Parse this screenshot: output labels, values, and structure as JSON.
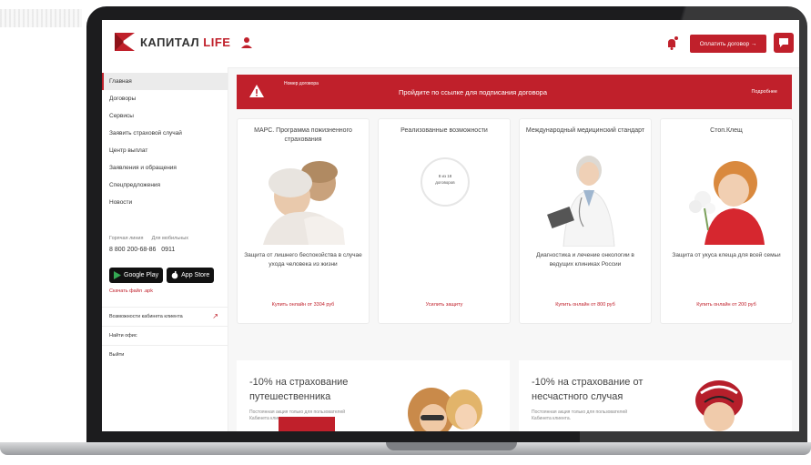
{
  "header": {
    "logo_text": "КАПИТАЛ",
    "logo_life": "LIFE",
    "pay_button": "Оплатить договор →"
  },
  "sidebar": {
    "items": [
      {
        "label": "Главная"
      },
      {
        "label": "Договоры"
      },
      {
        "label": "Сервисы"
      },
      {
        "label": "Заявить страховой случай"
      },
      {
        "label": "Центр выплат"
      },
      {
        "label": "Заявления и обращения"
      },
      {
        "label": "Спецпредложения"
      },
      {
        "label": "Новости"
      }
    ],
    "hotline_label": "Горячая линия",
    "mobile_label": "Для мобильных",
    "hotline_number": "8 800 200-68-86",
    "mobile_number": "0911",
    "google_play": "Google Play",
    "app_store": "App Store",
    "apk_link": "Скачать файл .apk",
    "cabinet_features": "Возможности кабинета клиента",
    "find_office": "Найти офис",
    "logout": "Выйти"
  },
  "banner": {
    "small_label": "Номер договора",
    "text": "Пройдите по ссылке для подписания договора",
    "link": "Подробнее"
  },
  "cards": [
    {
      "title": "МАРС. Программа пожизненного страхования",
      "desc": "Защита от лишнего беспокойства в случае ухода человека из жизни",
      "link": "Купить онлайн от 3304 руб"
    },
    {
      "title": "Реализованные возможности",
      "circle_top": "8 из 18",
      "circle_bottom": "договоров",
      "desc": "",
      "link": "Усилить защиту"
    },
    {
      "title": "Международный медицинский стандарт",
      "desc": "Диагностика и лечение онкологии в ведущих клиниках России",
      "link": "Купить онлайн от 800 руб"
    },
    {
      "title": "Стоп.Клещ",
      "desc": "Защита от укуса клеща для всей семьи",
      "link": "Купить онлайн от 200 руб"
    }
  ],
  "promos": [
    {
      "title": "-10% на страхование путешественника",
      "small": "Постоянная акция только для пользователей Кабинета клиента."
    },
    {
      "title": "-10% на страхование от несчастного случая",
      "small": "Постоянная акция только для пользователей Кабинета клиента."
    }
  ],
  "colors": {
    "brand": "#c0202b"
  }
}
